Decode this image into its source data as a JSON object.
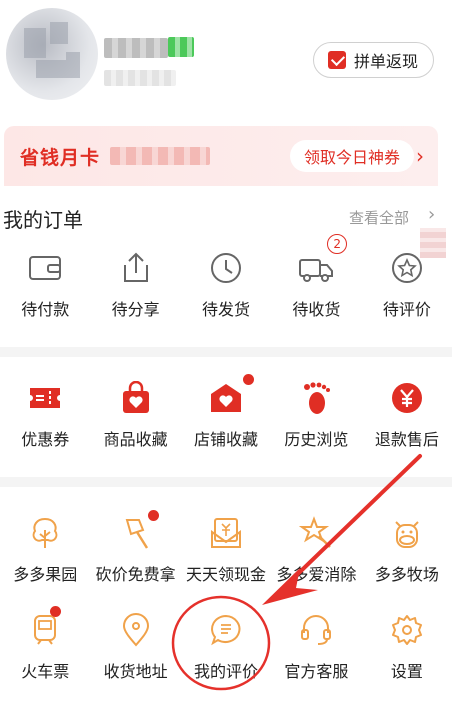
{
  "profile": {
    "group_button_label": "拼单返现"
  },
  "savings_card": {
    "title": "省钱月卡",
    "claim_label": "领取今日神券",
    "arrow": "›"
  },
  "orders": {
    "title": "我的订单",
    "view_all": "查看全部",
    "arrow": "›",
    "items": [
      {
        "label": "待付款",
        "icon": "wallet-icon"
      },
      {
        "label": "待分享",
        "icon": "share-icon"
      },
      {
        "label": "待发货",
        "icon": "clock-icon"
      },
      {
        "label": "待收货",
        "icon": "truck-icon",
        "badge": "2"
      },
      {
        "label": "待评价",
        "icon": "review-star-icon"
      }
    ]
  },
  "services": {
    "items": [
      {
        "label": "优惠券",
        "icon": "coupon-icon"
      },
      {
        "label": "商品收藏",
        "icon": "bag-heart-icon"
      },
      {
        "label": "店铺收藏",
        "icon": "store-heart-icon",
        "dot": true
      },
      {
        "label": "历史浏览",
        "icon": "footprint-icon"
      },
      {
        "label": "退款售后",
        "icon": "refund-yen-icon"
      }
    ]
  },
  "tools": {
    "row1": [
      {
        "label": "多多果园",
        "icon": "tree-icon"
      },
      {
        "label": "砍价免费拿",
        "icon": "axe-icon",
        "dot": true
      },
      {
        "label": "天天领现金",
        "icon": "cash-envelope-icon"
      },
      {
        "label": "多多爱消除",
        "icon": "star-wand-icon"
      },
      {
        "label": "多多牧场",
        "icon": "cow-icon"
      }
    ],
    "row2": [
      {
        "label": "火车票",
        "icon": "train-icon",
        "dot": true
      },
      {
        "label": "收货地址",
        "icon": "location-pin-icon"
      },
      {
        "label": "我的评价",
        "icon": "comment-bubble-icon"
      },
      {
        "label": "官方客服",
        "icon": "headset-icon"
      },
      {
        "label": "设置",
        "icon": "gear-icon"
      }
    ]
  },
  "colors": {
    "accent": "#e02e24",
    "tool_orange": "#f0a24a",
    "annotation": "#e5312b"
  }
}
